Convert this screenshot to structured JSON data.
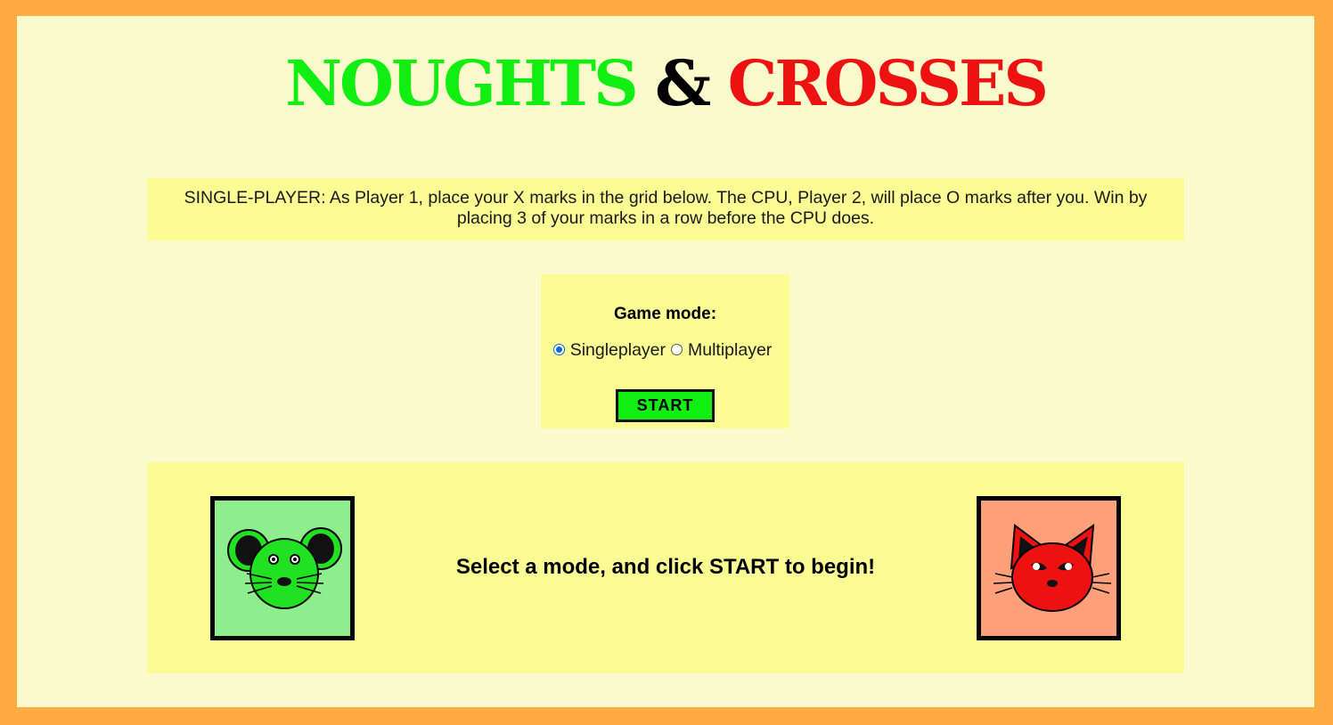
{
  "title": {
    "word1": "NOUGHTS",
    "amp": "&",
    "word2": "CROSSES"
  },
  "description": "SINGLE-PLAYER: As Player 1, place your X marks in the grid below. The CPU, Player 2, will place O marks after you. Win by placing 3 of your marks in a row before the CPU does.",
  "mode_panel": {
    "label": "Game mode:",
    "options": [
      {
        "label": "Singleplayer",
        "selected": true
      },
      {
        "label": "Multiplayer",
        "selected": false
      }
    ],
    "start_label": "START"
  },
  "game_panel": {
    "status": "Select a mode, and click START to begin!",
    "player1_icon": "mouse-icon",
    "player2_icon": "cat-icon"
  },
  "colors": {
    "background_border": "#ffad42",
    "page": "#fafacc",
    "panel": "#fcfc94",
    "noughts": "#11ee11",
    "crosses": "#ee1111",
    "player1_bg": "#8eee8e",
    "player2_bg": "#ffa07a"
  }
}
